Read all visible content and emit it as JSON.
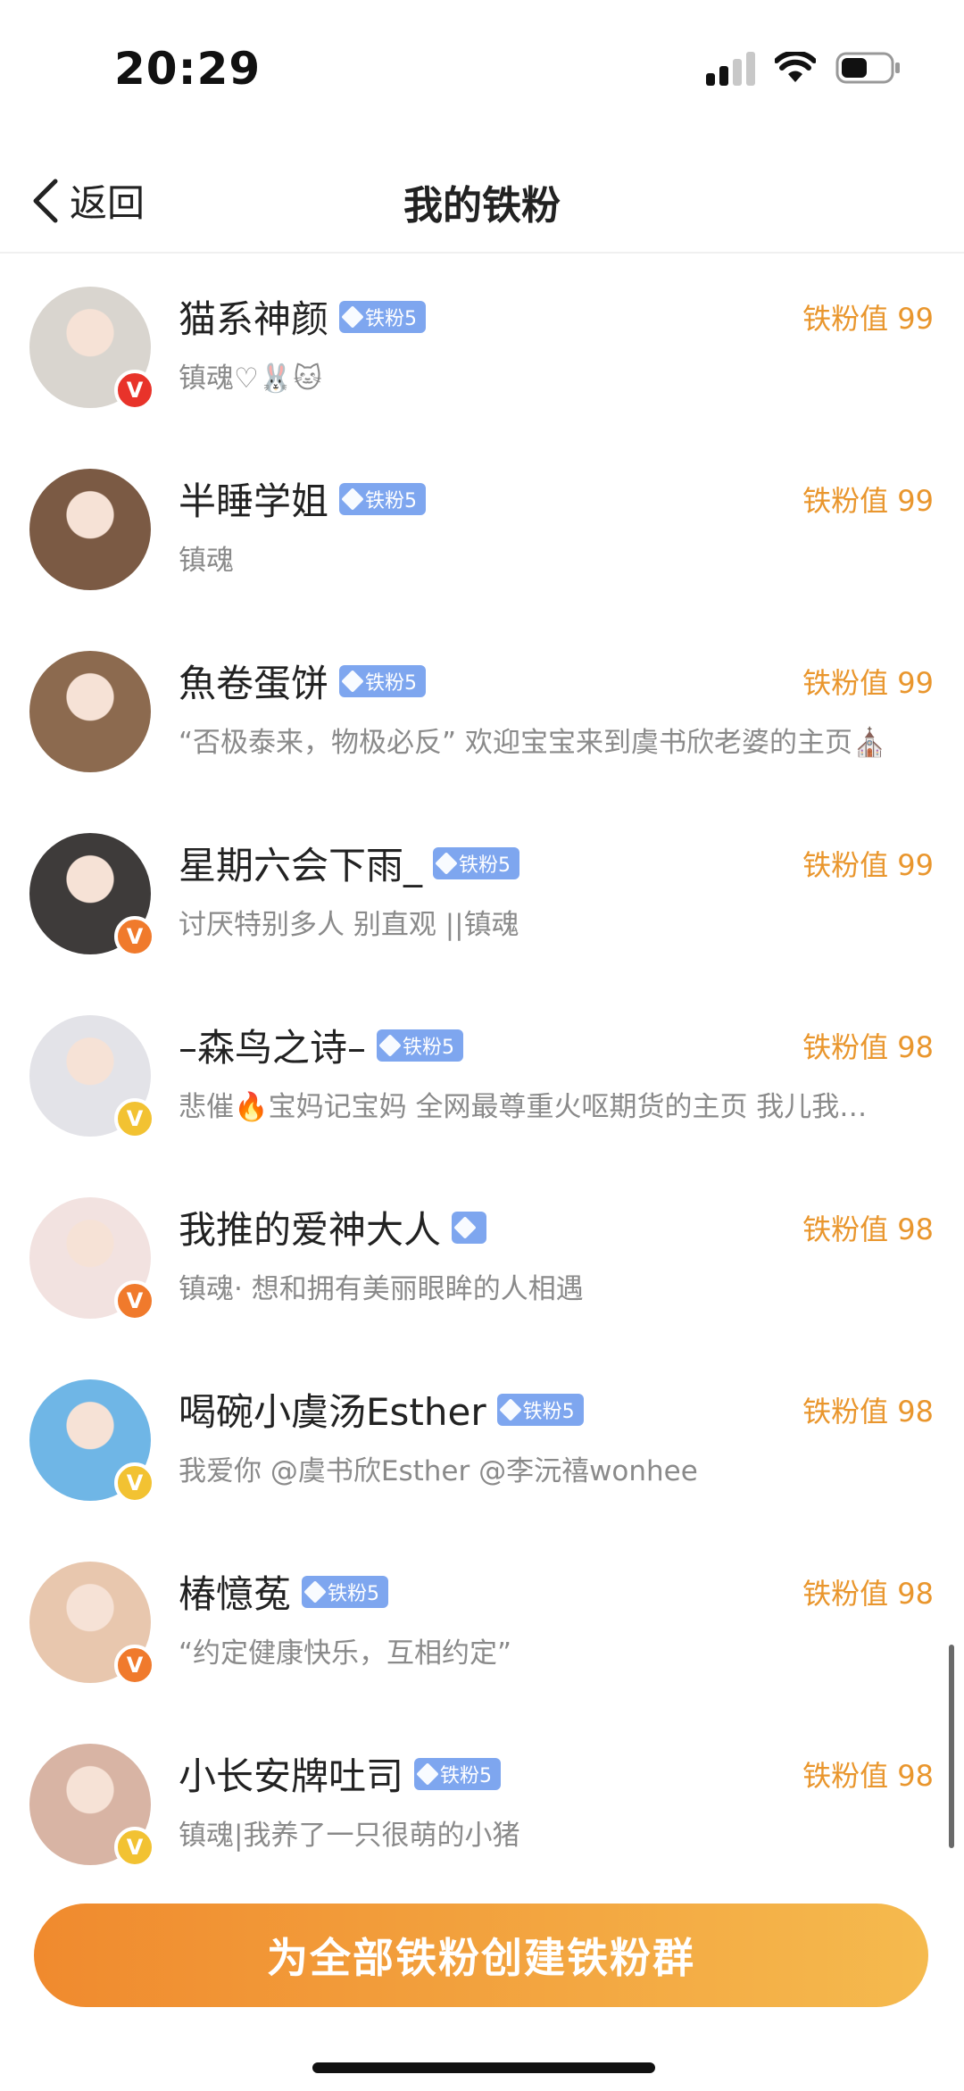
{
  "status_bar": {
    "time": "20:29",
    "icons": [
      "signal-icon",
      "wifi-icon",
      "battery-icon"
    ]
  },
  "nav": {
    "back_label": "返回",
    "title": "我的铁粉"
  },
  "fans": [
    {
      "name": "猫系神颜",
      "badge": "铁粉5",
      "bio": "镇魂♡🐰🐱",
      "score": "铁粉值 99",
      "verified": "red",
      "avatar_bg": "#d9d5cf"
    },
    {
      "name": "半睡学姐",
      "badge": "铁粉5",
      "bio": "镇魂",
      "score": "铁粉值 99",
      "verified": "",
      "avatar_bg": "#7b5a44"
    },
    {
      "name": "魚卷蛋饼",
      "badge": "铁粉5",
      "bio": "“否极泰来，物极必反” 欢迎宝宝来到虞书欣老婆的主页⛪",
      "score": "铁粉值 99",
      "verified": "",
      "avatar_bg": "#8c6a4f"
    },
    {
      "name": "星期六会下雨_",
      "badge": "铁粉5",
      "bio": "讨厌特别多人 别直观 ||镇魂",
      "score": "铁粉值 99",
      "verified": "orange",
      "avatar_bg": "#3e3b3a"
    },
    {
      "name": "–森鸟之诗–",
      "badge": "铁粉5",
      "bio": "悲催🔥宝妈记宝妈 全网最尊重火呕期货的主页 我儿我…",
      "score": "铁粉值 98",
      "verified": "gold",
      "avatar_bg": "#e3e3e8"
    },
    {
      "name": "我推的爱神大人",
      "badge": "",
      "bio": "镇魂· 想和拥有美丽眼眸的人相遇",
      "score": "铁粉值 98",
      "verified": "orange",
      "avatar_bg": "#f2e2e0"
    },
    {
      "name": "喝碗小虞汤Esther",
      "badge": "铁粉5",
      "bio": "我爱你 @虞书欣Esther @李沅禧wonhee",
      "score": "铁粉值 98",
      "verified": "gold",
      "avatar_bg": "#6fb6e6"
    },
    {
      "name": "椿憶菟",
      "badge": "铁粉5",
      "bio": "“约定健康快乐，互相约定”",
      "score": "铁粉值 98",
      "verified": "orange",
      "avatar_bg": "#e8c7ae"
    },
    {
      "name": "小长安牌吐司",
      "badge": "铁粉5",
      "bio": "镇魂|我养了一只很萌的小猪",
      "score": "铁粉值 98",
      "verified": "gold",
      "avatar_bg": "#d8b4a4"
    }
  ],
  "v_mark": "V",
  "bottom": {
    "button_label": "为全部铁粉创建铁粉群"
  },
  "colors": {
    "accent": "#e9962d",
    "badge": "#7ea6ef",
    "button_start": "#f08a2e",
    "button_end": "#f5ba4e"
  }
}
